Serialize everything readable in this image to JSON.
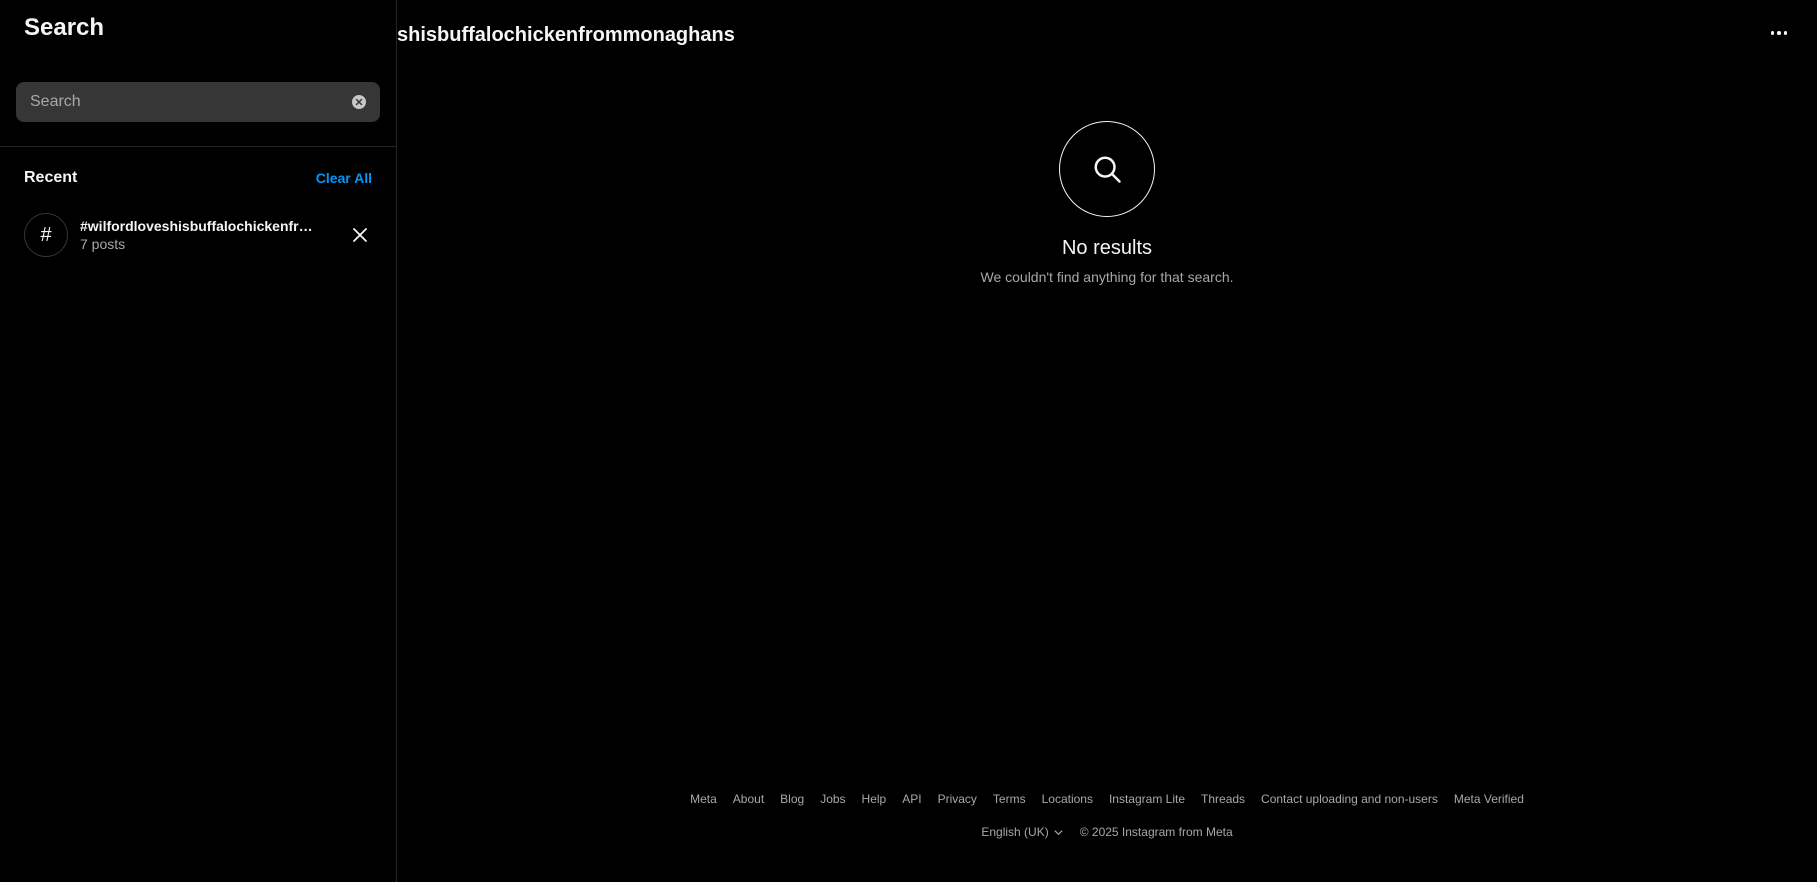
{
  "main": {
    "header_title": "shisbuffalochickenfrommonaghans",
    "more_options_icon": "more-horizontal-icon",
    "empty_state": {
      "icon": "search-icon",
      "title": "No results",
      "subtitle": "We couldn't find anything for that search."
    }
  },
  "search_panel": {
    "title": "Search",
    "input": {
      "value": "",
      "placeholder": "Search"
    },
    "recent_label": "Recent",
    "clear_all_label": "Clear All",
    "recent_items": [
      {
        "symbol": "#",
        "name": "#wilfordloveshisbuffalochickenfrom…",
        "subtitle": "7 posts"
      }
    ]
  },
  "footer": {
    "links": [
      "Meta",
      "About",
      "Blog",
      "Jobs",
      "Help",
      "API",
      "Privacy",
      "Terms",
      "Locations",
      "Instagram Lite",
      "Threads",
      "Contact uploading and non-users",
      "Meta Verified"
    ],
    "language": "English (UK)",
    "copyright": "© 2025 Instagram from Meta"
  },
  "colors": {
    "background": "#000000",
    "text_primary": "#f5f5f5",
    "text_secondary": "#a8a8a8",
    "accent": "#0095f6",
    "input_background": "#363636",
    "divider": "#262626"
  }
}
